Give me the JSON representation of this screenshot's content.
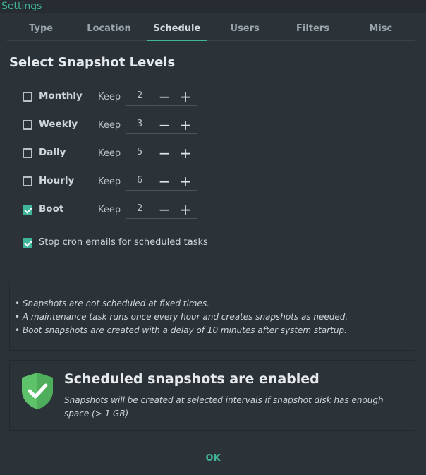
{
  "window": {
    "title": "Settings"
  },
  "tabs": [
    {
      "label": "Type"
    },
    {
      "label": "Location"
    },
    {
      "label": "Schedule",
      "active": true
    },
    {
      "label": "Users"
    },
    {
      "label": "Filters"
    },
    {
      "label": "Misc"
    }
  ],
  "heading": "Select Snapshot Levels",
  "keep_label": "Keep",
  "levels": [
    {
      "label": "Monthly",
      "checked": false,
      "keep": "2"
    },
    {
      "label": "Weekly",
      "checked": false,
      "keep": "3"
    },
    {
      "label": "Daily",
      "checked": false,
      "keep": "5"
    },
    {
      "label": "Hourly",
      "checked": false,
      "keep": "6"
    },
    {
      "label": "Boot",
      "checked": true,
      "keep": "2"
    }
  ],
  "spin_minus": "−",
  "spin_plus": "+",
  "cron": {
    "label": "Stop cron emails for scheduled tasks",
    "checked": true
  },
  "info": [
    "• Snapshots are not scheduled at fixed times.",
    "• A maintenance task runs once every hour and creates snapshots as needed.",
    "• Boot snapshots are created with a delay of 10 minutes after system startup."
  ],
  "status": {
    "title": "Scheduled snapshots are enabled",
    "message": "Snapshots will be created at selected intervals if snapshot disk has enough space (> 1 GB)",
    "icon": "shield-check-icon"
  },
  "ok_label": "OK",
  "colors": {
    "accent": "#3fb59a",
    "background": "#2b3238",
    "shield": "#5ec26a"
  }
}
